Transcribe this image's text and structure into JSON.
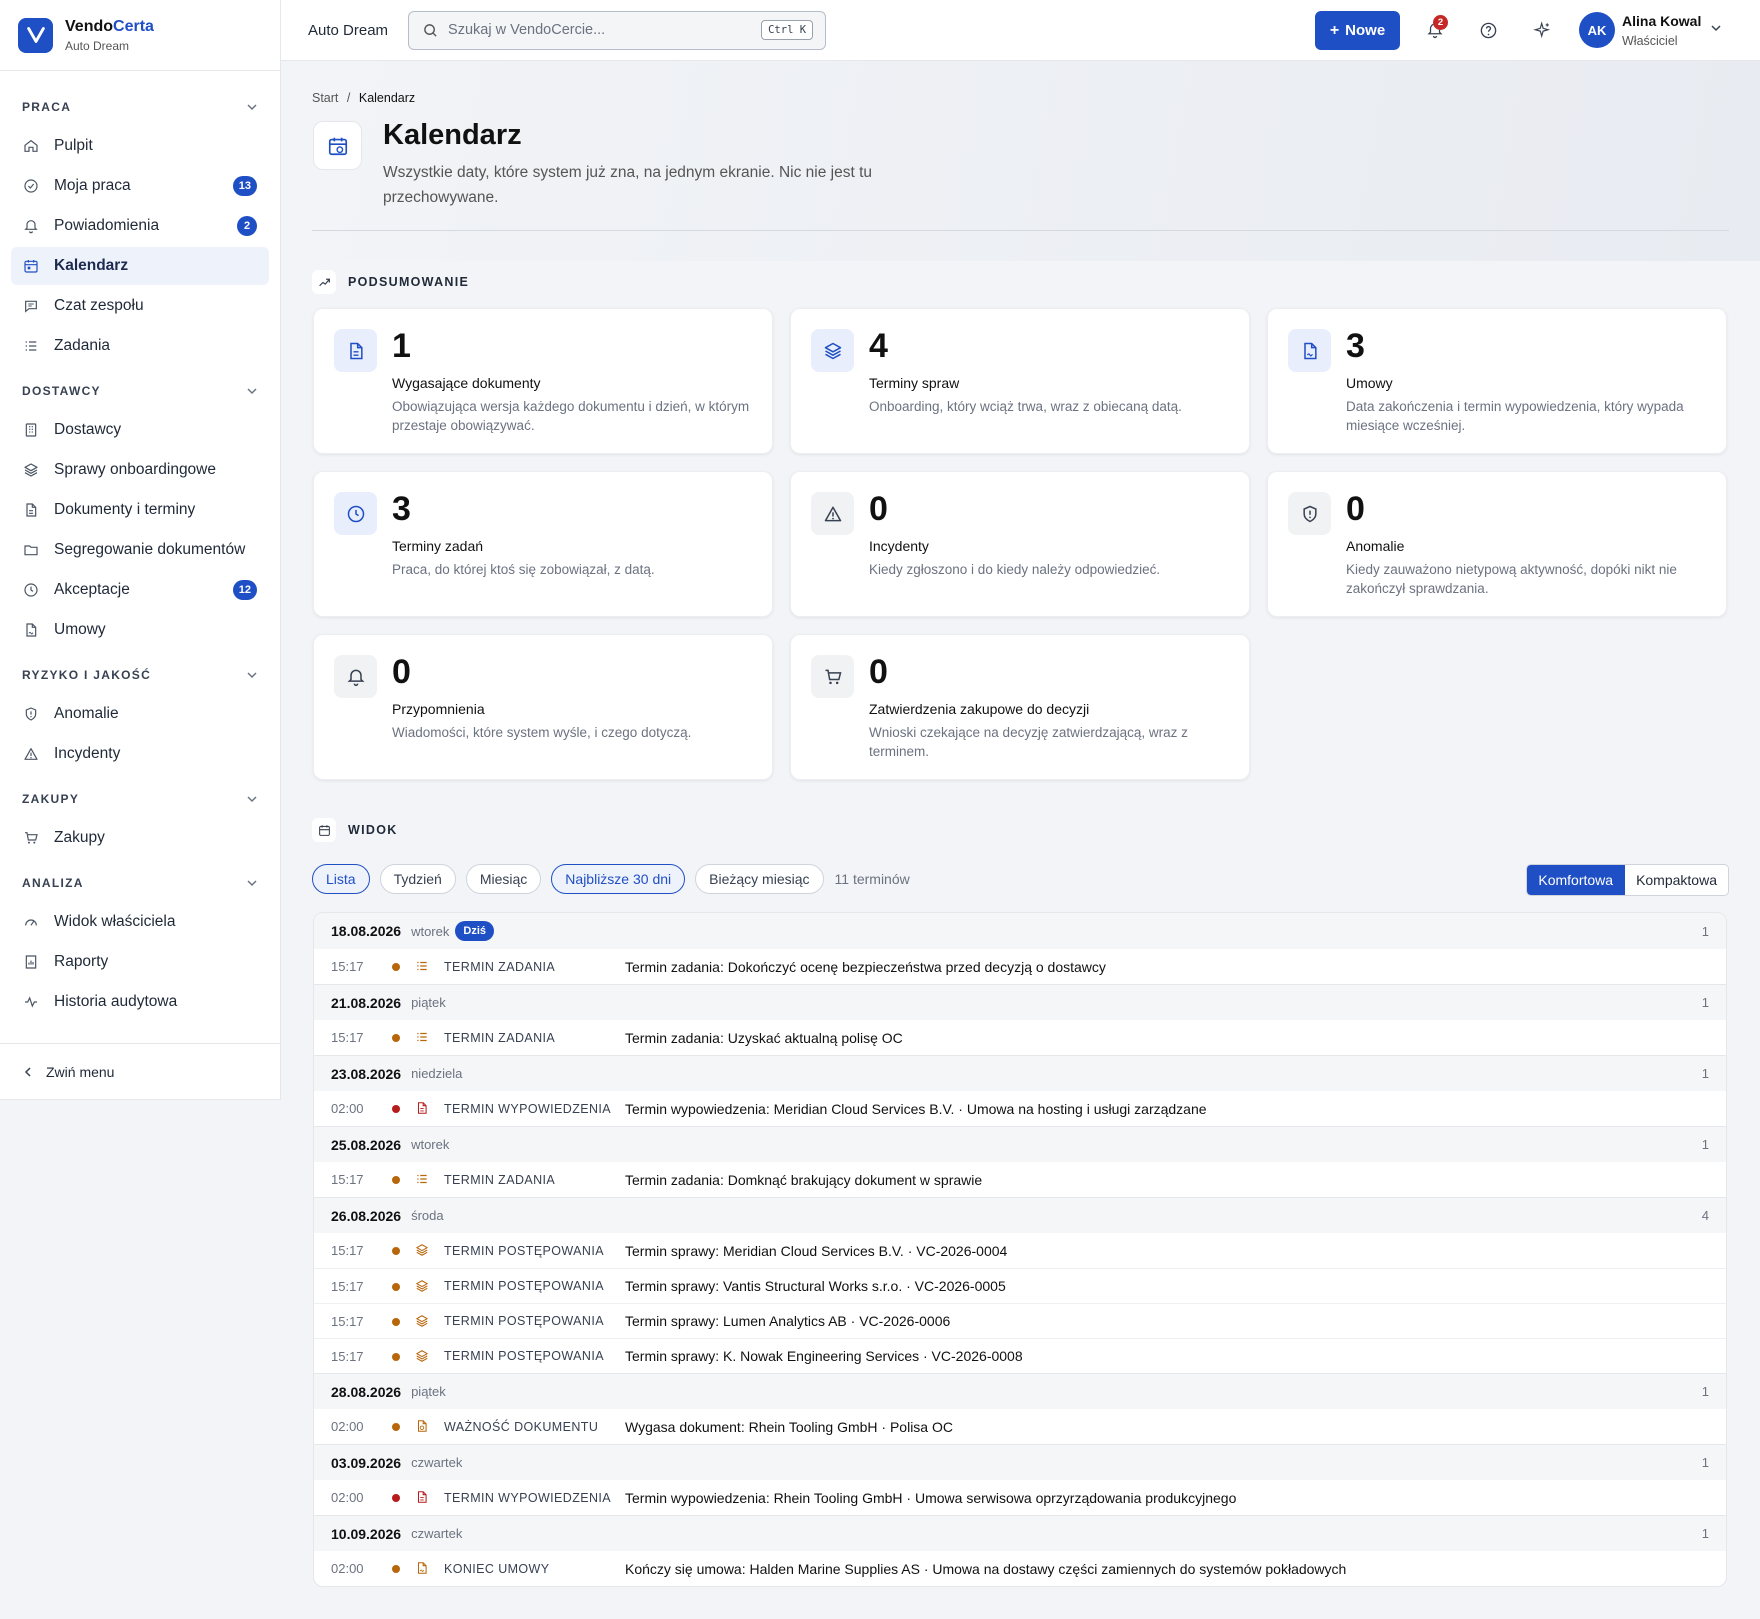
{
  "brand": {
    "name_a": "Vendo",
    "name_b": "Certa",
    "sub": "Auto Dream"
  },
  "sidebar": {
    "sections": [
      {
        "title": "PRACA",
        "items": [
          {
            "label": "Pulpit",
            "icon": "home-icon"
          },
          {
            "label": "Moja praca",
            "icon": "check-circle-icon",
            "badge": "13"
          },
          {
            "label": "Powiadomienia",
            "icon": "bell-icon",
            "badge": "2"
          },
          {
            "label": "Kalendarz",
            "icon": "calendar-icon",
            "active": true
          },
          {
            "label": "Czat zespołu",
            "icon": "chat-icon"
          },
          {
            "label": "Zadania",
            "icon": "task-list-icon"
          }
        ]
      },
      {
        "title": "DOSTAWCY",
        "items": [
          {
            "label": "Dostawcy",
            "icon": "building-icon"
          },
          {
            "label": "Sprawy onboardingowe",
            "icon": "layers-icon"
          },
          {
            "label": "Dokumenty i terminy",
            "icon": "document-icon"
          },
          {
            "label": "Segregowanie dokumentów",
            "icon": "folder-icon"
          },
          {
            "label": "Akceptacje",
            "icon": "clock-icon",
            "badge": "12"
          },
          {
            "label": "Umowy",
            "icon": "contract-icon"
          }
        ]
      },
      {
        "title": "RYZYKO I JAKOŚĆ",
        "items": [
          {
            "label": "Anomalie",
            "icon": "shield-icon"
          },
          {
            "label": "Incydenty",
            "icon": "warning-icon"
          }
        ]
      },
      {
        "title": "ZAKUPY",
        "items": [
          {
            "label": "Zakupy",
            "icon": "cart-icon"
          }
        ]
      },
      {
        "title": "ANALIZA",
        "items": [
          {
            "label": "Widok właściciela",
            "icon": "gauge-icon"
          },
          {
            "label": "Raporty",
            "icon": "report-icon"
          },
          {
            "label": "Historia audytowa",
            "icon": "activity-icon"
          }
        ]
      }
    ],
    "collapse_label": "Zwiń menu"
  },
  "topbar": {
    "app": "Auto Dream",
    "search_placeholder": "Szukaj w VendoCercie...",
    "shortcut": "Ctrl K",
    "new_label": "Nowe",
    "notif_count": "2",
    "user_initials": "AK",
    "user_name": "Alina Kowal",
    "user_role": "Właściciel"
  },
  "page": {
    "crumb_home": "Start",
    "crumb_current": "Kalendarz",
    "title": "Kalendarz",
    "desc": "Wszystkie daty, które system już zna, na jednym ekranie. Nic nie jest tu przechowywane."
  },
  "summary": {
    "title": "PODSUMOWANIE",
    "cards": [
      {
        "num": "1",
        "label": "Wygasające dokumenty",
        "desc": "Obowiązująca wersja każdego dokumentu i dzień, w którym przestaje obowiązywać.",
        "icon": "document-icon",
        "tone": "blue"
      },
      {
        "num": "4",
        "label": "Terminy spraw",
        "desc": "Onboarding, który wciąż trwa, wraz z obiecaną datą.",
        "icon": "layers-icon",
        "tone": "blue"
      },
      {
        "num": "3",
        "label": "Umowy",
        "desc": "Data zakończenia i termin wypowiedzenia, który wypada miesiące wcześniej.",
        "icon": "contract-icon",
        "tone": "blue"
      },
      {
        "num": "3",
        "label": "Terminy zadań",
        "desc": "Praca, do której ktoś się zobowiązał, z datą.",
        "icon": "clock-icon",
        "tone": "blue"
      },
      {
        "num": "0",
        "label": "Incydenty",
        "desc": "Kiedy zgłoszono i do kiedy należy odpowiedzieć.",
        "icon": "warning-icon",
        "tone": "gray"
      },
      {
        "num": "0",
        "label": "Anomalie",
        "desc": "Kiedy zauważono nietypową aktywność, dopóki nikt nie zakończył sprawdzania.",
        "icon": "shield-icon",
        "tone": "gray"
      },
      {
        "num": "0",
        "label": "Przypomnienia",
        "desc": "Wiadomości, które system wyśle, i czego dotyczą.",
        "icon": "bell-icon",
        "tone": "gray"
      },
      {
        "num": "0",
        "label": "Zatwierdzenia zakupowe do decyzji",
        "desc": "Wnioski czekające na decyzję zatwierdzającą, wraz z terminem.",
        "icon": "cart-icon",
        "tone": "gray"
      }
    ]
  },
  "view": {
    "title": "WIDOK",
    "tabs": [
      {
        "label": "Lista",
        "selected": true
      },
      {
        "label": "Tydzień"
      },
      {
        "label": "Miesiąc"
      },
      {
        "label": "Najbliższe 30 dni",
        "selected": true
      },
      {
        "label": "Bieżący miesiąc"
      }
    ],
    "count_label": "11 terminów",
    "density": [
      {
        "label": "Komfortowa",
        "on": true
      },
      {
        "label": "Kompaktowa"
      }
    ]
  },
  "colors": {
    "accent": "#1f4fc4",
    "orange": "#b8660b",
    "red": "#b71c1c"
  },
  "days": [
    {
      "date": "18.08.2026",
      "weekday": "wtorek",
      "today": "Dziś",
      "count": "1",
      "events": [
        {
          "time": "15:17",
          "color": "orange",
          "icon": "task-list-icon",
          "kind": "TERMIN ZADANIA",
          "title": "Termin zadania: Dokończyć ocenę bezpieczeństwa przed decyzją o dostawcy"
        }
      ]
    },
    {
      "date": "21.08.2026",
      "weekday": "piątek",
      "count": "1",
      "events": [
        {
          "time": "15:17",
          "color": "orange",
          "icon": "task-list-icon",
          "kind": "TERMIN ZADANIA",
          "title": "Termin zadania: Uzyskać aktualną polisę OC"
        }
      ]
    },
    {
      "date": "23.08.2026",
      "weekday": "niedziela",
      "count": "1",
      "events": [
        {
          "time": "02:00",
          "color": "red",
          "icon": "document-icon",
          "kind": "TERMIN WYPOWIEDZENIA",
          "title": "Termin wypowiedzenia: Meridian Cloud Services B.V. · Umowa na hosting i usługi zarządzane"
        }
      ]
    },
    {
      "date": "25.08.2026",
      "weekday": "wtorek",
      "count": "1",
      "events": [
        {
          "time": "15:17",
          "color": "orange",
          "icon": "task-list-icon",
          "kind": "TERMIN ZADANIA",
          "title": "Termin zadania: Domknąć brakujący dokument w sprawie"
        }
      ]
    },
    {
      "date": "26.08.2026",
      "weekday": "środa",
      "count": "4",
      "events": [
        {
          "time": "15:17",
          "color": "orange",
          "icon": "layers-icon",
          "kind": "TERMIN POSTĘPOWANIA",
          "title": "Termin sprawy: Meridian Cloud Services B.V. · VC-2026-0004"
        },
        {
          "time": "15:17",
          "color": "orange",
          "icon": "layers-icon",
          "kind": "TERMIN POSTĘPOWANIA",
          "title": "Termin sprawy: Vantis Structural Works s.r.o. · VC-2026-0005"
        },
        {
          "time": "15:17",
          "color": "orange",
          "icon": "layers-icon",
          "kind": "TERMIN POSTĘPOWANIA",
          "title": "Termin sprawy: Lumen Analytics AB · VC-2026-0006"
        },
        {
          "time": "15:17",
          "color": "orange",
          "icon": "layers-icon",
          "kind": "TERMIN POSTĘPOWANIA",
          "title": "Termin sprawy: K. Nowak Engineering Services · VC-2026-0008"
        }
      ]
    },
    {
      "date": "28.08.2026",
      "weekday": "piątek",
      "count": "1",
      "events": [
        {
          "time": "02:00",
          "color": "orange",
          "icon": "doc-clock-icon",
          "kind": "WAŻNOŚĆ DOKUMENTU",
          "title": "Wygasa dokument: Rhein Tooling GmbH · Polisa OC"
        }
      ]
    },
    {
      "date": "03.09.2026",
      "weekday": "czwartek",
      "count": "1",
      "events": [
        {
          "time": "02:00",
          "color": "red",
          "icon": "document-icon",
          "kind": "TERMIN WYPOWIEDZENIA",
          "title": "Termin wypowiedzenia: Rhein Tooling GmbH · Umowa serwisowa oprzyrządowania produkcyjnego"
        }
      ]
    },
    {
      "date": "10.09.2026",
      "weekday": "czwartek",
      "count": "1",
      "events": [
        {
          "time": "02:00",
          "color": "orange",
          "icon": "contract-icon",
          "kind": "KONIEC UMOWY",
          "title": "Kończy się umowa: Halden Marine Supplies AS · Umowa na dostawy części zamiennych do systemów pokładowych"
        }
      ]
    }
  ]
}
